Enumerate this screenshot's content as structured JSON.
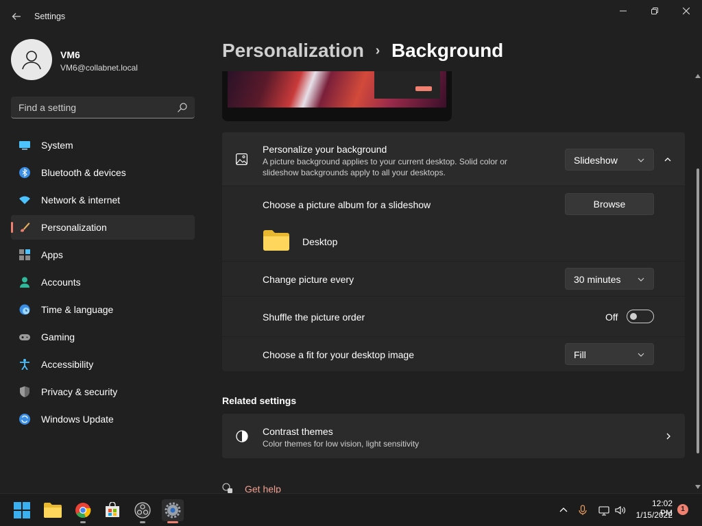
{
  "window": {
    "title": "Settings"
  },
  "user": {
    "name": "VM6",
    "email": "VM6@collabnet.local"
  },
  "search": {
    "placeholder": "Find a setting"
  },
  "sidebar": {
    "items": [
      {
        "label": "System",
        "icon": "system-icon"
      },
      {
        "label": "Bluetooth & devices",
        "icon": "bluetooth-icon"
      },
      {
        "label": "Network & internet",
        "icon": "wifi-icon"
      },
      {
        "label": "Personalization",
        "icon": "brush-icon",
        "active": true
      },
      {
        "label": "Apps",
        "icon": "apps-icon"
      },
      {
        "label": "Accounts",
        "icon": "accounts-icon"
      },
      {
        "label": "Time & language",
        "icon": "clock-globe-icon"
      },
      {
        "label": "Gaming",
        "icon": "gamepad-icon"
      },
      {
        "label": "Accessibility",
        "icon": "accessibility-icon"
      },
      {
        "label": "Privacy & security",
        "icon": "shield-icon"
      },
      {
        "label": "Windows Update",
        "icon": "update-icon"
      }
    ]
  },
  "breadcrumb": {
    "parent": "Personalization",
    "separator": "›",
    "current": "Background"
  },
  "background": {
    "title": "Personalize your background",
    "description_line1": "A picture background applies to your current desktop. Solid color or",
    "description_line2": "slideshow backgrounds apply to all your desktops.",
    "type_value": "Slideshow",
    "album_label": "Choose a picture album for a slideshow",
    "browse_label": "Browse",
    "album_name": "Desktop",
    "interval_label": "Change picture every",
    "interval_value": "30 minutes",
    "shuffle_label": "Shuffle the picture order",
    "shuffle_state": "Off",
    "fit_label": "Choose a fit for your desktop image",
    "fit_value": "Fill"
  },
  "related": {
    "heading": "Related settings",
    "contrast_title": "Contrast themes",
    "contrast_desc": "Color themes for low vision, light sensitivity"
  },
  "help": {
    "label": "Get help"
  },
  "taskbar": {
    "time": "12:02 PM",
    "date": "1/15/2022",
    "notifications": "1"
  },
  "colors": {
    "accent": "#f08070",
    "background": "#202020",
    "card": "#2b2b2b"
  }
}
